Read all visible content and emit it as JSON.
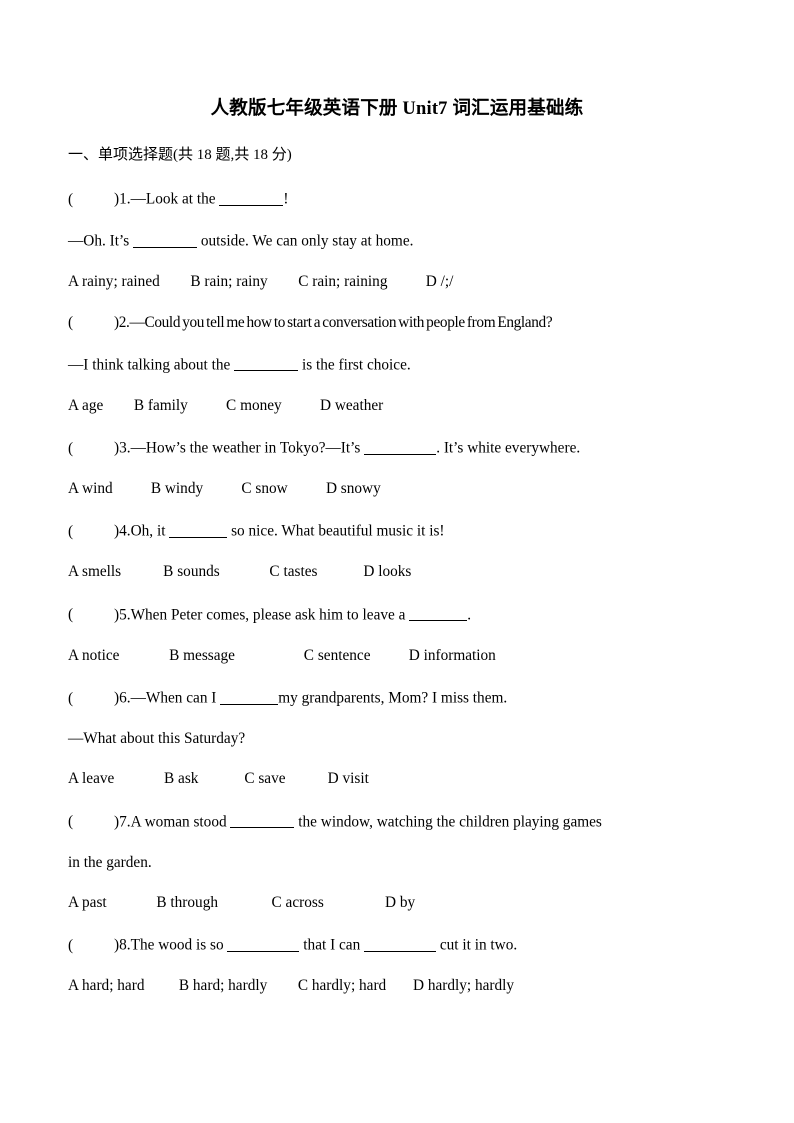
{
  "document": {
    "title": "人教版七年级英语下册 Unit7 词汇运用基础练",
    "section_heading": "一、单项选择题(共 18 题,共 18 分)",
    "paren_marker": "(",
    "paren_close": ")"
  },
  "questions": [
    {
      "number": "1.",
      "stem_before": "—Look at the ",
      "stem_after": "!",
      "second_line": "—Oh. It’s",
      "second_line_after": "outside. We can only stay at home.",
      "options": "A rainy; rained        B rain; rainy        C rain; raining          D /;/"
    },
    {
      "number": "2.",
      "stem_full": "—Could you tell me how to start a conversation with people from England?",
      "second_line": "—I think talking about the",
      "second_line_after": "is the first choice.",
      "options": "A age        B family          C money          D weather"
    },
    {
      "number": "3.",
      "stem_before": "—How’s the weather in Tokyo?—It’s ",
      "stem_after": ". It’s white everywhere.",
      "options": "A wind          B windy          C snow          D snowy"
    },
    {
      "number": "4.",
      "stem_before": "Oh, it ",
      "stem_after": " so nice. What beautiful music it is!",
      "options": "A smells           B sounds             C tastes            D looks"
    },
    {
      "number": "5.",
      "stem_before": "When Peter comes, please ask him to leave a ",
      "stem_after": ".",
      "options": "A notice             B message                  C sentence          D information"
    },
    {
      "number": "6.",
      "stem_before": "—When can I ",
      "stem_after": "my grandparents, Mom? I miss them.",
      "second_line": "—What about this Saturday?",
      "options": "A leave             B ask            C save           D visit"
    },
    {
      "number": "7.",
      "stem_before": "A woman stood ",
      "stem_after": " the window, watching the children playing games",
      "second_line": "in the garden.",
      "options": "A past             B through              C across                D by"
    },
    {
      "number": "8.",
      "stem_before": "The wood is so ",
      "stem_mid": " that I can ",
      "stem_after": " cut it in two.",
      "options": "A hard; hard         B hard; hardly        C hardly; hard       D hardly; hardly"
    }
  ]
}
